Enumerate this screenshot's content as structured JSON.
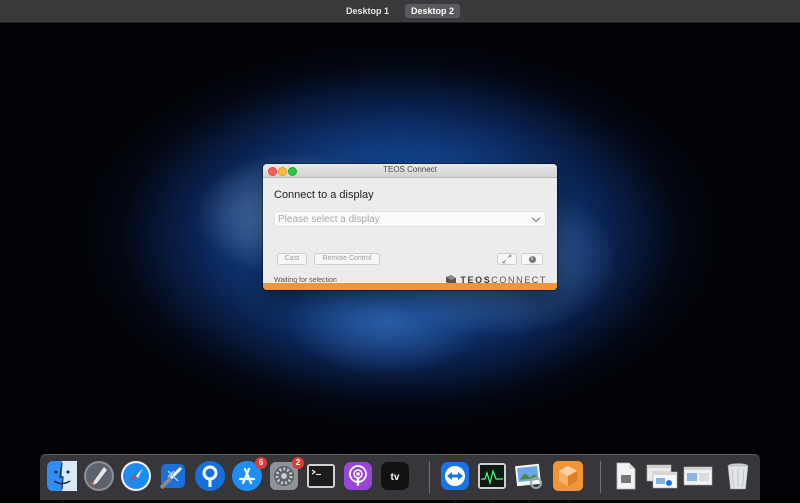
{
  "mission_control": {
    "spaces": [
      {
        "label": "Desktop 1",
        "active": false
      },
      {
        "label": "Desktop 2",
        "active": true
      }
    ]
  },
  "window": {
    "title": "TEOS Connect",
    "heading": "Connect to a display",
    "select_placeholder": "Please select a display",
    "buttons": {
      "cast": "Cast",
      "remote_control": "Remote Control",
      "expand_icon": "expand-icon",
      "info_icon": "info-icon"
    },
    "status": "Waiting for selection",
    "logo": {
      "bold": "TEOS",
      "light": "CONNECT"
    },
    "accent_color": "#f0953a"
  },
  "dock": {
    "items": [
      {
        "name": "Finder",
        "icon": "finder-icon",
        "running": true
      },
      {
        "name": "Launchpad",
        "icon": "launchpad-icon",
        "running": false
      },
      {
        "name": "Safari",
        "icon": "safari-icon",
        "running": false
      },
      {
        "name": "Xcode",
        "icon": "xcode-icon",
        "running": false
      },
      {
        "name": "Sourcetree",
        "icon": "sourcetree-icon",
        "running": false
      },
      {
        "name": "App Store",
        "icon": "appstore-icon",
        "running": false,
        "badge": "6"
      },
      {
        "name": "System Preferences",
        "icon": "system-preferences-icon",
        "running": false,
        "badge": "2"
      },
      {
        "name": "Terminal",
        "icon": "terminal-icon",
        "running": false
      },
      {
        "name": "Podcasts",
        "icon": "podcasts-icon",
        "running": false
      },
      {
        "name": "TV",
        "icon": "tv-icon",
        "running": false
      },
      {
        "name": "TeamViewer",
        "icon": "teamviewer-icon",
        "running": true
      },
      {
        "name": "Activity Monitor",
        "icon": "activity-monitor-icon",
        "running": true
      },
      {
        "name": "Preview",
        "icon": "preview-icon",
        "running": true
      },
      {
        "name": "TEOS Connect",
        "icon": "teos-connect-icon",
        "running": true
      },
      {
        "name": "Document",
        "icon": "document-icon",
        "running": false
      },
      {
        "name": "Window Stack",
        "icon": "window-stack-icon",
        "running": false
      },
      {
        "name": "Trash",
        "icon": "trash-icon",
        "running": false
      }
    ]
  }
}
